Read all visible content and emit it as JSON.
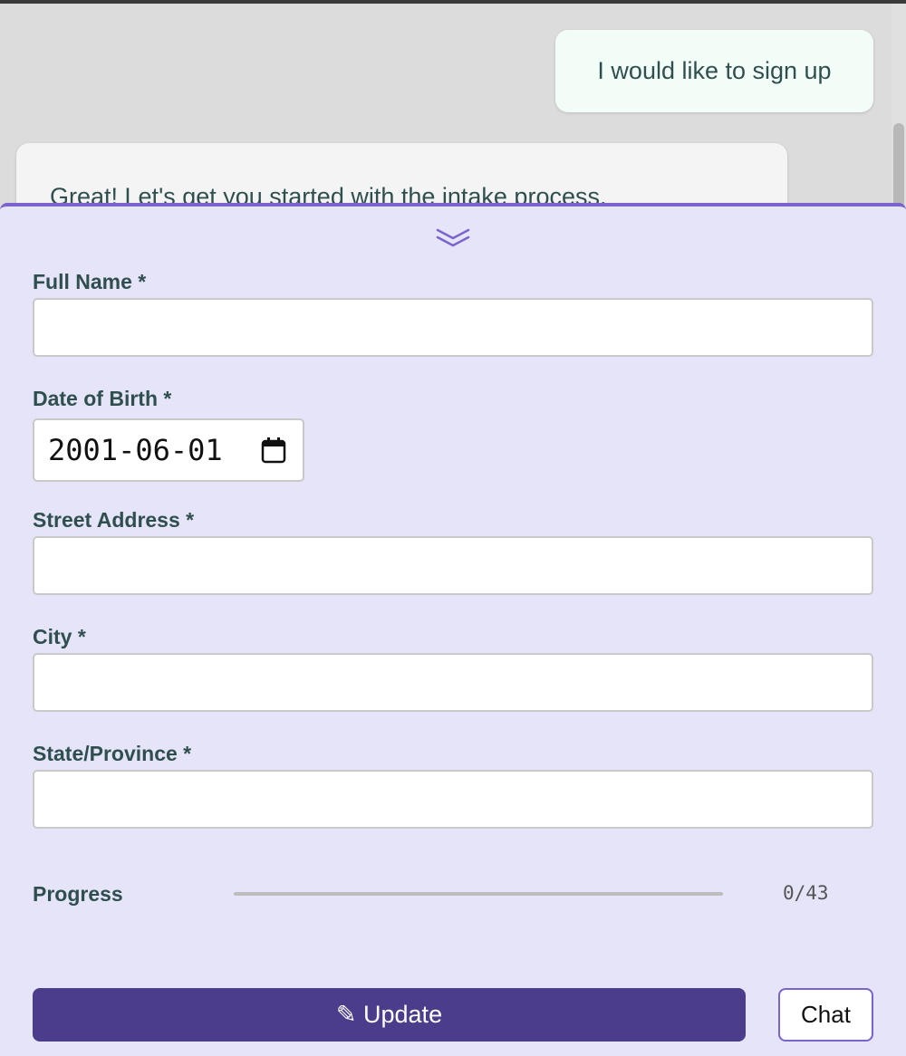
{
  "chat": {
    "messages": [
      {
        "role": "user",
        "text": "I would like to sign up"
      },
      {
        "role": "assistant",
        "text": "Great! Let's get you started with the intake process."
      }
    ]
  },
  "form": {
    "collapse_icon": "double-chevron-down-icon",
    "fields": [
      {
        "label": "Full Name *",
        "value": ""
      },
      {
        "label": "Date of Birth *",
        "value": "2001-06-01",
        "icon": "calendar-icon"
      },
      {
        "label": "Street Address *",
        "value": ""
      },
      {
        "label": "City *",
        "value": ""
      },
      {
        "label": "State/Province *",
        "value": ""
      }
    ]
  },
  "progress": {
    "label": "Progress",
    "current": 0,
    "total": 43,
    "text": "0/43"
  },
  "actions": {
    "update_label": "✎ Update",
    "chat_label": "Chat"
  },
  "colors": {
    "accent": "#7a63cc",
    "button_primary": "#4b3c8c",
    "panel_background": "#e6e4f9",
    "user_bubble": "#f3fdf8"
  }
}
